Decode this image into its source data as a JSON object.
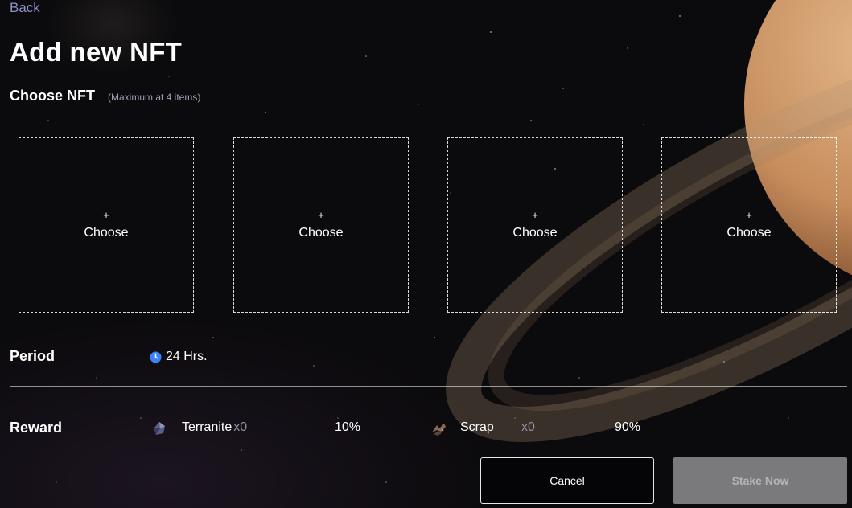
{
  "nav": {
    "back_label": "Back"
  },
  "page": {
    "title": "Add new NFT",
    "choose_label": "Choose NFT",
    "choose_hint": "(Maximum at 4 items)"
  },
  "slots": [
    {
      "plus": "+",
      "label": "Choose"
    },
    {
      "plus": "+",
      "label": "Choose"
    },
    {
      "plus": "+",
      "label": "Choose"
    },
    {
      "plus": "+",
      "label": "Choose"
    }
  ],
  "period": {
    "label": "Period",
    "icon": "clock-icon",
    "value": "24 Hrs."
  },
  "reward": {
    "label": "Reward",
    "items": [
      {
        "icon": "terranite-icon",
        "name": "Terranite",
        "count": "x0",
        "percent": "10%"
      },
      {
        "icon": "scrap-icon",
        "name": "Scrap",
        "count": "x0",
        "percent": "90%"
      }
    ]
  },
  "buttons": {
    "cancel": "Cancel",
    "stake": "Stake Now"
  },
  "colors": {
    "back_link": "#8a92c8",
    "clock": "#3b82f6",
    "stake_disabled": "#7a7a7c"
  }
}
